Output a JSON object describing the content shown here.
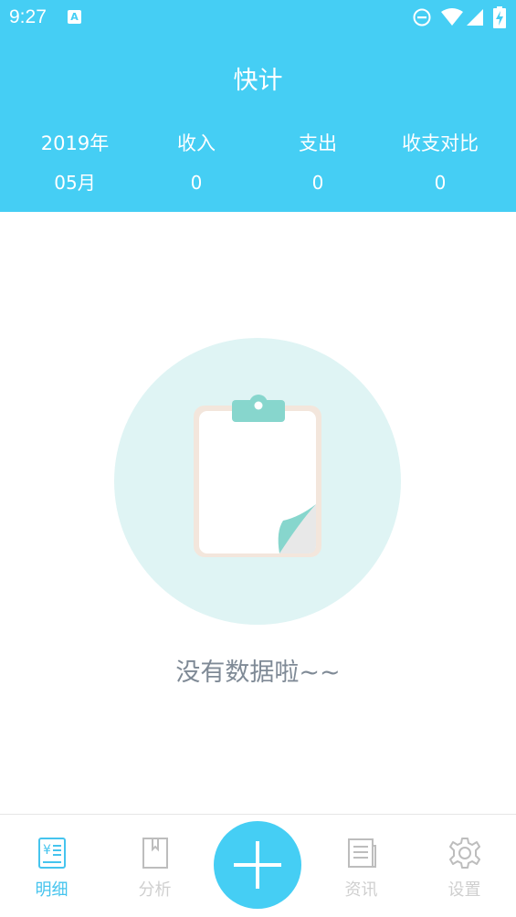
{
  "status_bar": {
    "time": "9:27",
    "notification_icon": "A"
  },
  "header": {
    "title": "快计",
    "summary": [
      {
        "label": "2019年",
        "value": "05月"
      },
      {
        "label": "收入",
        "value": "0"
      },
      {
        "label": "支出",
        "value": "0"
      },
      {
        "label": "收支对比",
        "value": "0"
      }
    ]
  },
  "empty_state": {
    "message": "没有数据啦~~",
    "icon": "clipboard-icon"
  },
  "tabbar": {
    "tabs": [
      {
        "label": "明细",
        "icon": "ledger-icon",
        "active": true
      },
      {
        "label": "分析",
        "icon": "book-icon",
        "active": false
      },
      {
        "label": "资讯",
        "icon": "news-icon",
        "active": false
      },
      {
        "label": "设置",
        "icon": "gear-icon",
        "active": false
      }
    ],
    "add_icon": "plus-icon"
  },
  "colors": {
    "primary": "#45cef4",
    "active_tab": "#45c4ee",
    "inactive_tab": "#cfcfcf",
    "empty_circle": "#dff4f4",
    "empty_text": "#7f8a96"
  }
}
